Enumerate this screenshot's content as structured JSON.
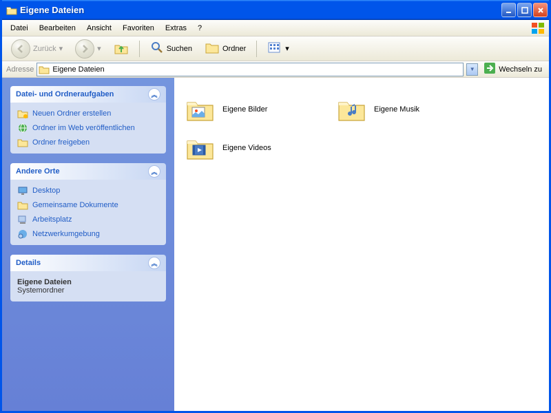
{
  "window": {
    "title": "Eigene Dateien"
  },
  "menu": {
    "items": [
      "Datei",
      "Bearbeiten",
      "Ansicht",
      "Favoriten",
      "Extras",
      "?"
    ]
  },
  "toolbar": {
    "back": "Zurück",
    "search": "Suchen",
    "folders": "Ordner"
  },
  "address": {
    "label": "Adresse",
    "value": "Eigene Dateien",
    "go": "Wechseln zu"
  },
  "panels": {
    "tasks": {
      "title": "Datei- und Ordneraufgaben",
      "items": [
        "Neuen Ordner erstellen",
        "Ordner im Web veröffentlichen",
        "Ordner freigeben"
      ]
    },
    "places": {
      "title": "Andere Orte",
      "items": [
        "Desktop",
        "Gemeinsame Dokumente",
        "Arbeitsplatz",
        "Netzwerkumgebung"
      ]
    },
    "details": {
      "title": "Details",
      "name": "Eigene Dateien",
      "type": "Systemordner"
    }
  },
  "files": [
    {
      "label": "Eigene Bilder",
      "overlay": "picture"
    },
    {
      "label": "Eigene Musik",
      "overlay": "music"
    },
    {
      "label": "Eigene Videos",
      "overlay": "video"
    }
  ]
}
